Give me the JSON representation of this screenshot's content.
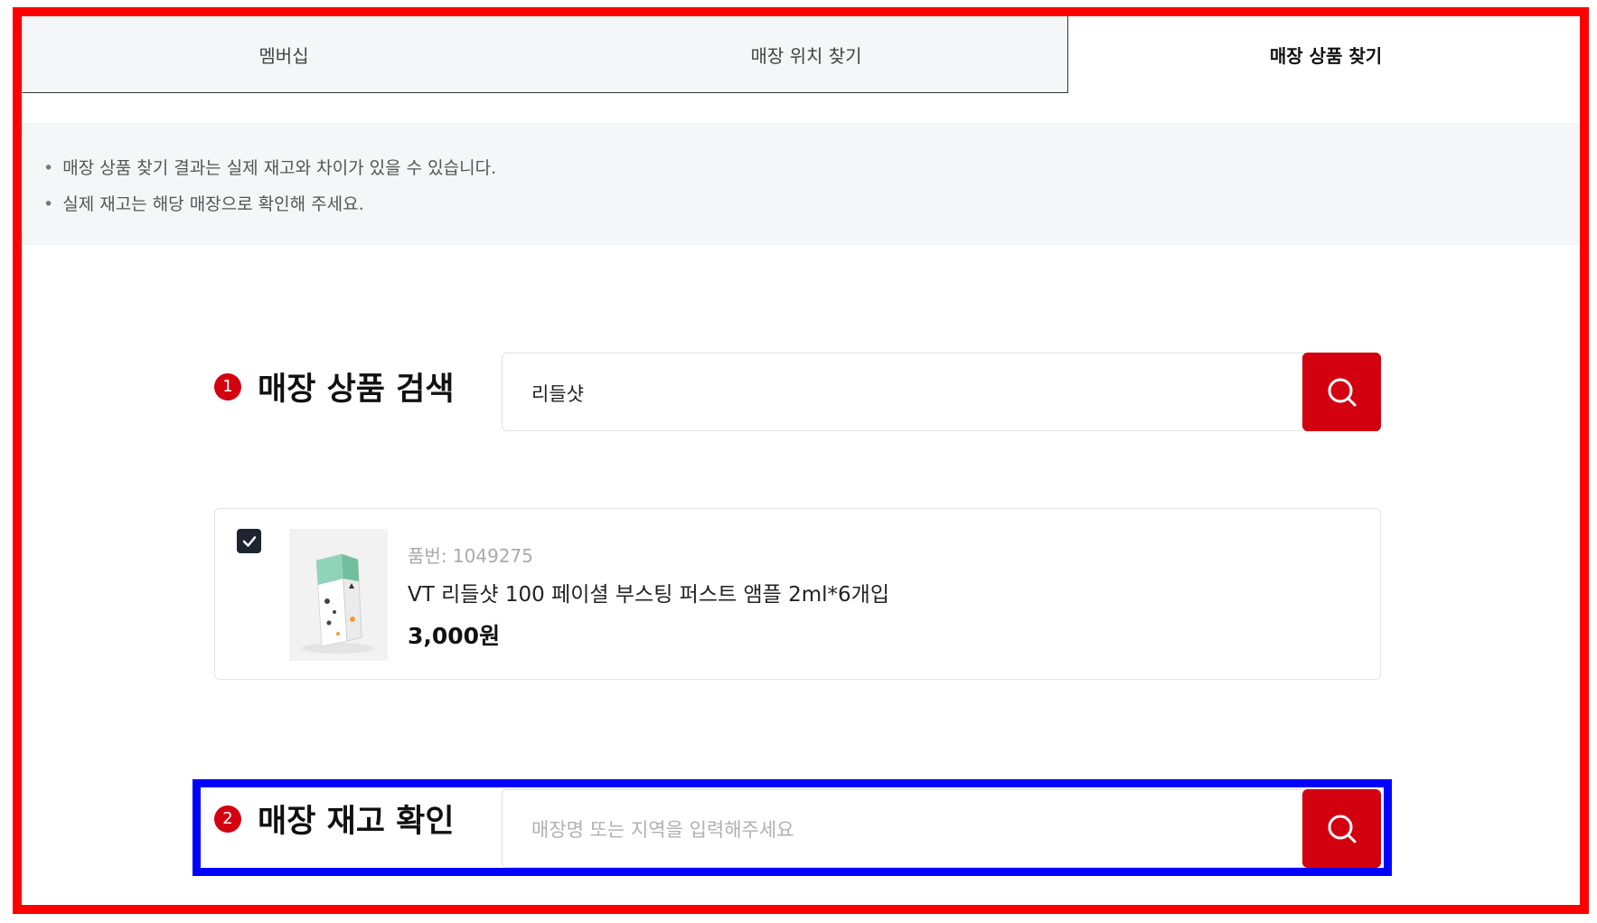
{
  "tabs": [
    {
      "label": "멤버십",
      "active": false
    },
    {
      "label": "매장 위치 찾기",
      "active": false
    },
    {
      "label": "매장 상품 찾기",
      "active": true
    }
  ],
  "notice": {
    "lines": [
      "매장 상품 찾기 결과는 실제 재고와 차이가 있을 수 있습니다.",
      "실제 재고는 해당 매장으로 확인해 주세요."
    ]
  },
  "product_search": {
    "step": "1",
    "title": "매장 상품 검색",
    "value": "리들샷",
    "placeholder": ""
  },
  "product": {
    "checked": true,
    "code": "품번: 1049275",
    "name": "VT 리들샷 100 페이셜 부스팅 퍼스트 앰플 2ml*6개입",
    "price": "3,000원"
  },
  "stock_check": {
    "step": "2",
    "title": "매장 재고 확인",
    "value": "",
    "placeholder": "매장명 또는 지역을 입력해주세요"
  },
  "colors": {
    "accent": "#d30010",
    "highlight_red": "#ff0000",
    "highlight_blue": "#0000ff"
  },
  "icons": {
    "search": "search-icon",
    "check": "check-icon"
  }
}
